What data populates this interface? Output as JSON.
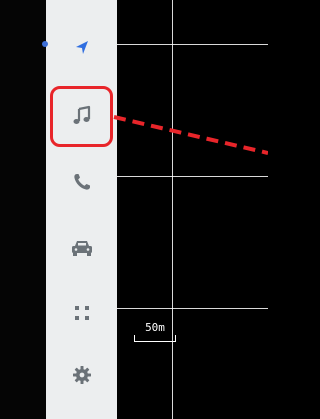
{
  "map": {
    "scale_label": "50m"
  },
  "sidebar": {
    "items": [
      {
        "name": "navigation",
        "icon": "navigation-arrow-icon",
        "active": true
      },
      {
        "name": "music",
        "icon": "music-note-icon",
        "highlighted": true
      },
      {
        "name": "phone",
        "icon": "phone-icon"
      },
      {
        "name": "car",
        "icon": "car-icon"
      },
      {
        "name": "apps",
        "icon": "apps-grid-icon"
      },
      {
        "name": "settings",
        "icon": "gear-icon"
      }
    ]
  },
  "colors": {
    "sidebar_bg": "#eceeef",
    "icon_gray": "#6b7278",
    "nav_blue": "#2f6ee0",
    "annotation_red": "#e8252a",
    "map_bg": "#000000",
    "grid_line": "#ffffff"
  }
}
